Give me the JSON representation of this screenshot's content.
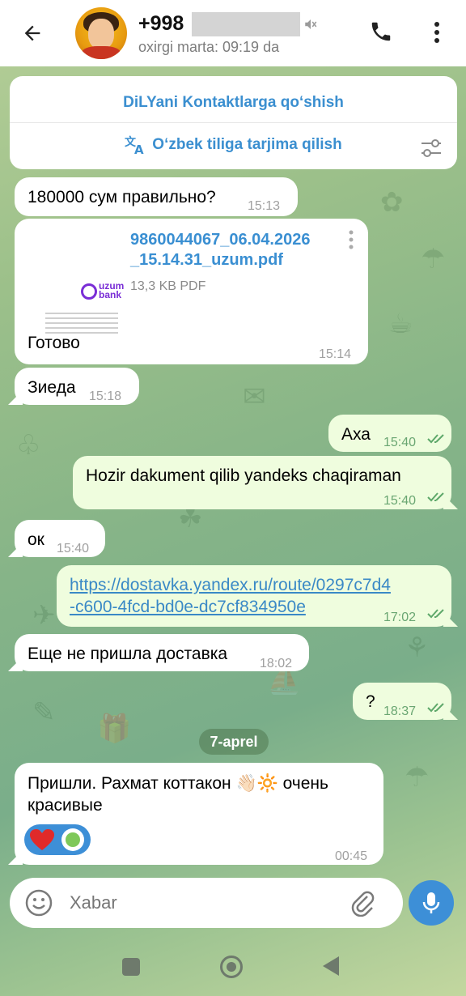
{
  "header": {
    "name": "+998",
    "status": "oxirgi marta: 09:19 da"
  },
  "contact_card": {
    "add_contact": "DiLYani Kontaktlarga qo‘shish",
    "translate": "O‘zbek tiliga tarjima qilish"
  },
  "messages": {
    "m1": {
      "text": "180000 сум правильно?",
      "time": "15:13"
    },
    "m2": {
      "file_name_1": "9860044067_06.04.2026",
      "file_name_2": "_15.14.31_uzum.pdf",
      "file_size": "13,3 KB PDF",
      "caption": "Готово",
      "time": "15:14",
      "thumb_logo": "uzum\nbank"
    },
    "m3": {
      "text": "Зиеда",
      "time": "15:18"
    },
    "m4": {
      "text": "Аха",
      "time": "15:40"
    },
    "m5": {
      "text": "Hozir dakument qilib yandeks chaqiraman",
      "time": "15:40"
    },
    "m6": {
      "text": "ок",
      "time": "15:40"
    },
    "m7": {
      "link_1": "https://dostavka.yandex.ru/route/0297c7d4",
      "link_2": "-c600-4fcd-bd0e-dc7cf834950e",
      "time": "17:02"
    },
    "m8": {
      "text": "Еще не пришла доставка",
      "time": "18:02"
    },
    "m9": {
      "text": "?",
      "time": "18:37"
    },
    "date_separator": "7-aprel",
    "m10": {
      "text_1": "Пришли. Рахмат коттакон 👋🏻🔆 очень",
      "text_2": "красивые",
      "time": "00:45"
    }
  },
  "input": {
    "placeholder": "Xabar"
  },
  "colors": {
    "accent": "#3d8fd7",
    "outgoing_bubble": "#effdde",
    "incoming_bubble": "#ffffff",
    "link": "#3a89c6"
  }
}
